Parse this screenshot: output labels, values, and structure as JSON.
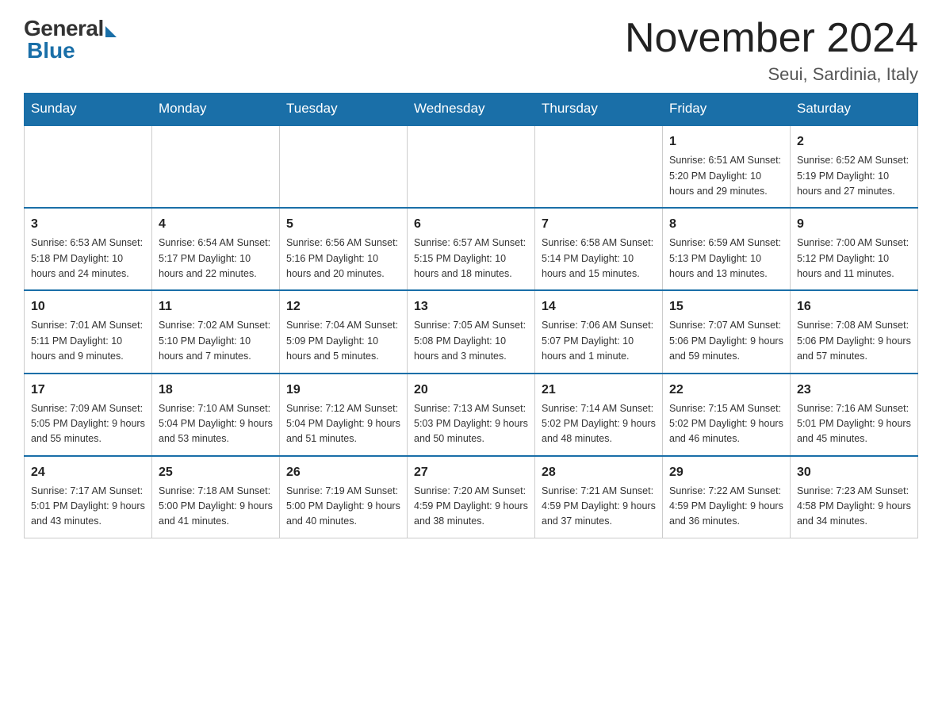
{
  "logo": {
    "general": "General",
    "blue": "Blue"
  },
  "title": "November 2024",
  "subtitle": "Seui, Sardinia, Italy",
  "days_of_week": [
    "Sunday",
    "Monday",
    "Tuesday",
    "Wednesday",
    "Thursday",
    "Friday",
    "Saturday"
  ],
  "weeks": [
    [
      {
        "day": "",
        "info": ""
      },
      {
        "day": "",
        "info": ""
      },
      {
        "day": "",
        "info": ""
      },
      {
        "day": "",
        "info": ""
      },
      {
        "day": "",
        "info": ""
      },
      {
        "day": "1",
        "info": "Sunrise: 6:51 AM\nSunset: 5:20 PM\nDaylight: 10 hours and 29 minutes."
      },
      {
        "day": "2",
        "info": "Sunrise: 6:52 AM\nSunset: 5:19 PM\nDaylight: 10 hours and 27 minutes."
      }
    ],
    [
      {
        "day": "3",
        "info": "Sunrise: 6:53 AM\nSunset: 5:18 PM\nDaylight: 10 hours and 24 minutes."
      },
      {
        "day": "4",
        "info": "Sunrise: 6:54 AM\nSunset: 5:17 PM\nDaylight: 10 hours and 22 minutes."
      },
      {
        "day": "5",
        "info": "Sunrise: 6:56 AM\nSunset: 5:16 PM\nDaylight: 10 hours and 20 minutes."
      },
      {
        "day": "6",
        "info": "Sunrise: 6:57 AM\nSunset: 5:15 PM\nDaylight: 10 hours and 18 minutes."
      },
      {
        "day": "7",
        "info": "Sunrise: 6:58 AM\nSunset: 5:14 PM\nDaylight: 10 hours and 15 minutes."
      },
      {
        "day": "8",
        "info": "Sunrise: 6:59 AM\nSunset: 5:13 PM\nDaylight: 10 hours and 13 minutes."
      },
      {
        "day": "9",
        "info": "Sunrise: 7:00 AM\nSunset: 5:12 PM\nDaylight: 10 hours and 11 minutes."
      }
    ],
    [
      {
        "day": "10",
        "info": "Sunrise: 7:01 AM\nSunset: 5:11 PM\nDaylight: 10 hours and 9 minutes."
      },
      {
        "day": "11",
        "info": "Sunrise: 7:02 AM\nSunset: 5:10 PM\nDaylight: 10 hours and 7 minutes."
      },
      {
        "day": "12",
        "info": "Sunrise: 7:04 AM\nSunset: 5:09 PM\nDaylight: 10 hours and 5 minutes."
      },
      {
        "day": "13",
        "info": "Sunrise: 7:05 AM\nSunset: 5:08 PM\nDaylight: 10 hours and 3 minutes."
      },
      {
        "day": "14",
        "info": "Sunrise: 7:06 AM\nSunset: 5:07 PM\nDaylight: 10 hours and 1 minute."
      },
      {
        "day": "15",
        "info": "Sunrise: 7:07 AM\nSunset: 5:06 PM\nDaylight: 9 hours and 59 minutes."
      },
      {
        "day": "16",
        "info": "Sunrise: 7:08 AM\nSunset: 5:06 PM\nDaylight: 9 hours and 57 minutes."
      }
    ],
    [
      {
        "day": "17",
        "info": "Sunrise: 7:09 AM\nSunset: 5:05 PM\nDaylight: 9 hours and 55 minutes."
      },
      {
        "day": "18",
        "info": "Sunrise: 7:10 AM\nSunset: 5:04 PM\nDaylight: 9 hours and 53 minutes."
      },
      {
        "day": "19",
        "info": "Sunrise: 7:12 AM\nSunset: 5:04 PM\nDaylight: 9 hours and 51 minutes."
      },
      {
        "day": "20",
        "info": "Sunrise: 7:13 AM\nSunset: 5:03 PM\nDaylight: 9 hours and 50 minutes."
      },
      {
        "day": "21",
        "info": "Sunrise: 7:14 AM\nSunset: 5:02 PM\nDaylight: 9 hours and 48 minutes."
      },
      {
        "day": "22",
        "info": "Sunrise: 7:15 AM\nSunset: 5:02 PM\nDaylight: 9 hours and 46 minutes."
      },
      {
        "day": "23",
        "info": "Sunrise: 7:16 AM\nSunset: 5:01 PM\nDaylight: 9 hours and 45 minutes."
      }
    ],
    [
      {
        "day": "24",
        "info": "Sunrise: 7:17 AM\nSunset: 5:01 PM\nDaylight: 9 hours and 43 minutes."
      },
      {
        "day": "25",
        "info": "Sunrise: 7:18 AM\nSunset: 5:00 PM\nDaylight: 9 hours and 41 minutes."
      },
      {
        "day": "26",
        "info": "Sunrise: 7:19 AM\nSunset: 5:00 PM\nDaylight: 9 hours and 40 minutes."
      },
      {
        "day": "27",
        "info": "Sunrise: 7:20 AM\nSunset: 4:59 PM\nDaylight: 9 hours and 38 minutes."
      },
      {
        "day": "28",
        "info": "Sunrise: 7:21 AM\nSunset: 4:59 PM\nDaylight: 9 hours and 37 minutes."
      },
      {
        "day": "29",
        "info": "Sunrise: 7:22 AM\nSunset: 4:59 PM\nDaylight: 9 hours and 36 minutes."
      },
      {
        "day": "30",
        "info": "Sunrise: 7:23 AM\nSunset: 4:58 PM\nDaylight: 9 hours and 34 minutes."
      }
    ]
  ]
}
